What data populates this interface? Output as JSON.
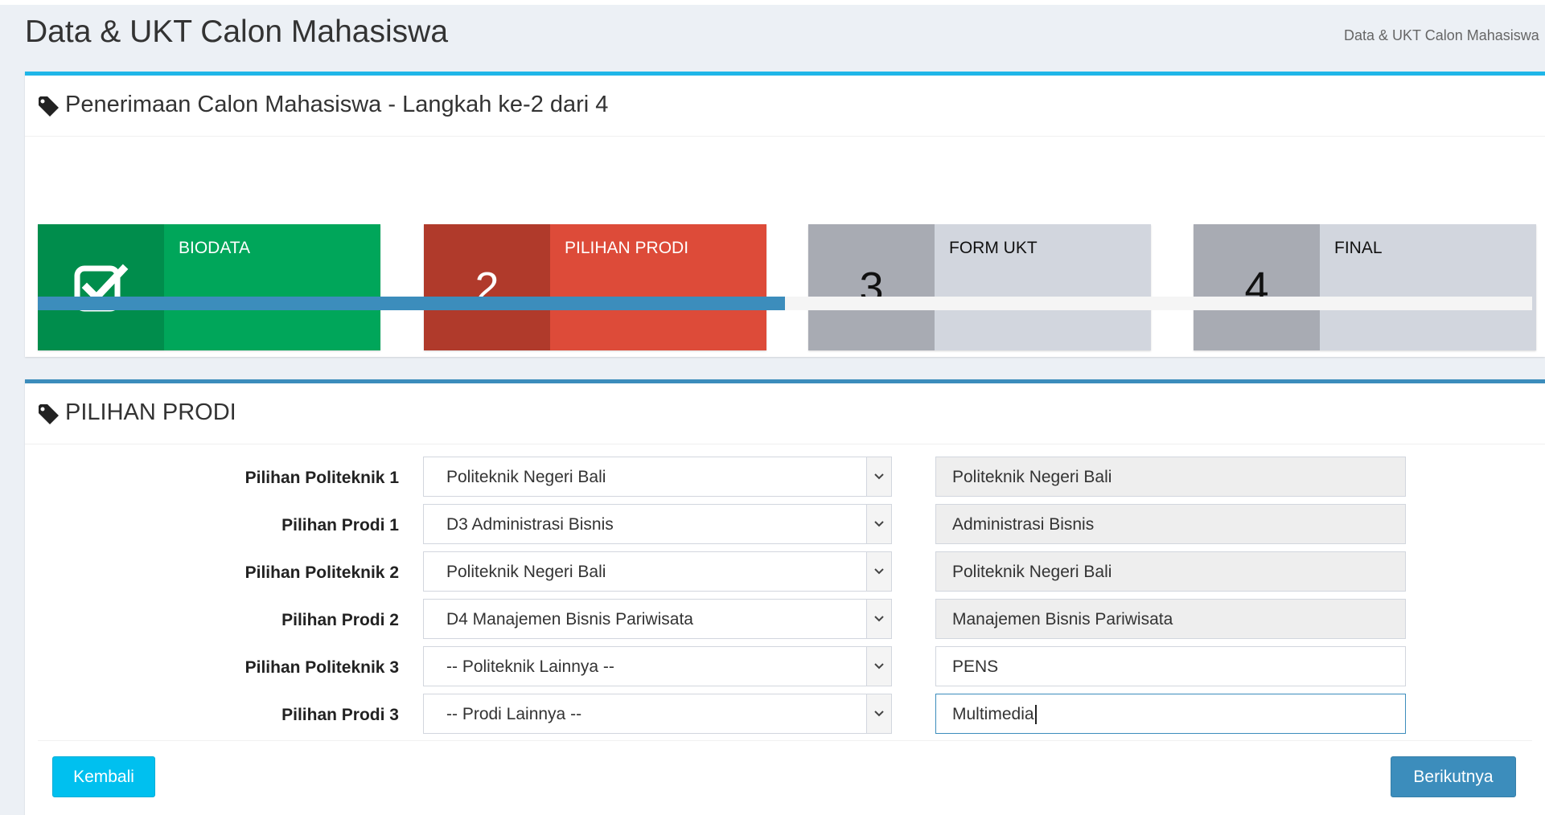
{
  "header": {
    "title": "Data & UKT Calon Mahasiswa",
    "breadcrumb": "Data & UKT Calon Mahasiswa"
  },
  "wizard": {
    "title": "Penerimaan Calon Mahasiswa - Langkah ke-2 dari 4",
    "steps": [
      {
        "number": "",
        "label": "BIODATA",
        "state": "done",
        "icon": "check-square-icon"
      },
      {
        "number": "2",
        "label": "PILIHAN PRODI",
        "state": "active"
      },
      {
        "number": "3",
        "label": "FORM UKT",
        "state": "pending"
      },
      {
        "number": "4",
        "label": "FINAL",
        "state": "pending"
      }
    ],
    "progress_fraction": 0.5
  },
  "form": {
    "title": "PILIHAN PRODI",
    "rows": [
      {
        "label": "Pilihan Politeknik 1",
        "select_value": "Politeknik Negeri Bali",
        "text_value": "Politeknik Negeri Bali",
        "readonly": true
      },
      {
        "label": "Pilihan Prodi 1",
        "select_value": "D3 Administrasi Bisnis",
        "text_value": "Administrasi Bisnis",
        "readonly": true
      },
      {
        "label": "Pilihan Politeknik 2",
        "select_value": "Politeknik Negeri Bali",
        "text_value": "Politeknik Negeri Bali",
        "readonly": true
      },
      {
        "label": "Pilihan Prodi 2",
        "select_value": "D4 Manajemen Bisnis Pariwisata",
        "text_value": "Manajemen Bisnis Pariwisata",
        "readonly": true
      },
      {
        "label": "Pilihan Politeknik 3",
        "select_value": "-- Politeknik Lainnya --",
        "text_value": "PENS",
        "readonly": false
      },
      {
        "label": "Pilihan Prodi 3",
        "select_value": "-- Prodi Lainnya --",
        "text_value": "Multimedia",
        "readonly": false
      }
    ],
    "back_label": "Kembali",
    "next_label": "Berikutnya"
  },
  "colors": {
    "done": "#00a65a",
    "active": "#dd4b39",
    "pending": "#d2d6de",
    "primary": "#3c8dbc",
    "info": "#00c0ef"
  }
}
